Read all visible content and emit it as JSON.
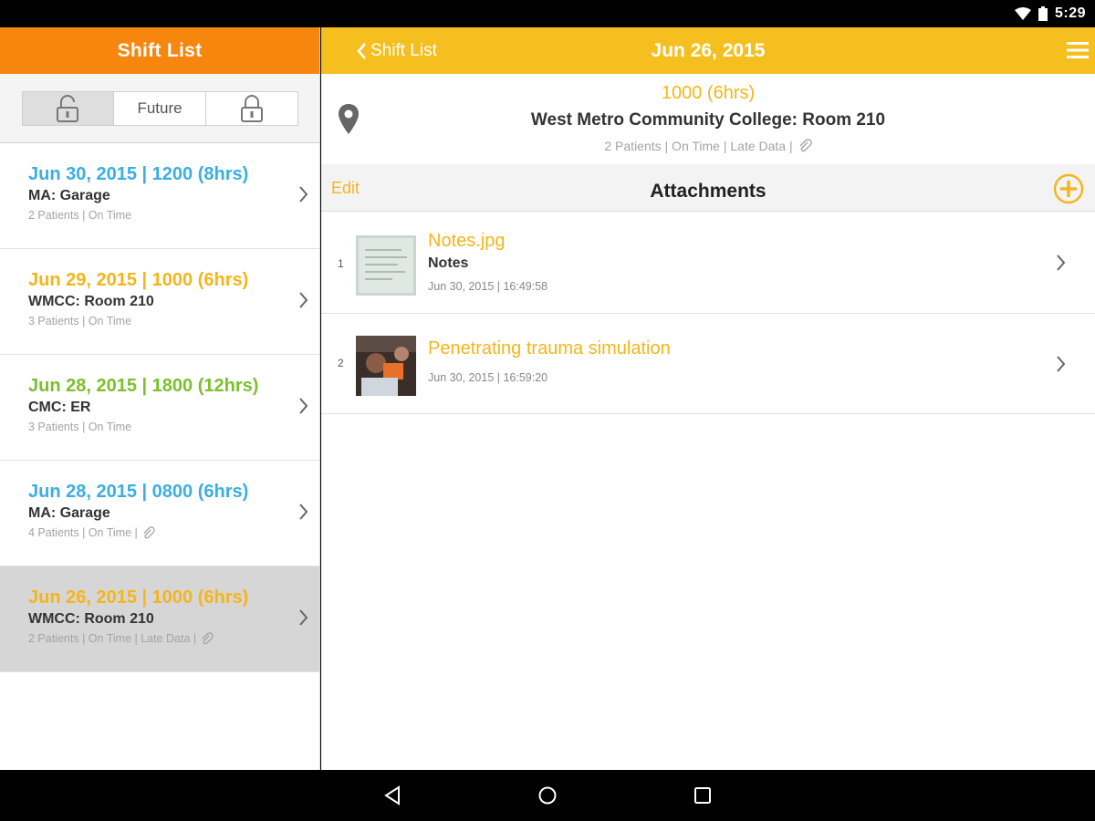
{
  "status": {
    "time": "5:29"
  },
  "left": {
    "header": "Shift List",
    "segments": {
      "future": "Future"
    },
    "shifts": [
      {
        "title": "Jun 30, 2015 | 1200 (8hrs)",
        "location": "MA: Garage",
        "meta": "2 Patients | On Time",
        "color": "#3aaee3",
        "attachment": false,
        "selected": false
      },
      {
        "title": "Jun 29, 2015 | 1000 (6hrs)",
        "location": "WMCC: Room 210",
        "meta": "3 Patients | On Time",
        "color": "#f5b51a",
        "attachment": false,
        "selected": false
      },
      {
        "title": "Jun 28, 2015 | 1800 (12hrs)",
        "location": "CMC: ER",
        "meta": "3 Patients | On Time",
        "color": "#7cc02a",
        "attachment": false,
        "selected": false
      },
      {
        "title": "Jun 28, 2015 | 0800 (6hrs)",
        "location": "MA: Garage",
        "meta": "4 Patients | On Time |",
        "color": "#3aaee3",
        "attachment": true,
        "selected": false
      },
      {
        "title": "Jun 26, 2015 | 1000 (6hrs)",
        "location": "WMCC: Room 210",
        "meta": "2 Patients | On Time | Late Data |",
        "color": "#f5b51a",
        "attachment": true,
        "selected": true
      }
    ]
  },
  "right": {
    "back_label": "Shift List",
    "title": "Jun 26, 2015",
    "detail": {
      "time": "1000 (6hrs)",
      "place": "West Metro Community College: Room 210",
      "meta": "2 Patients | On Time | Late Data |"
    },
    "attachments_bar": {
      "edit": "Edit",
      "title": "Attachments"
    },
    "attachments": [
      {
        "num": "1",
        "name": "Notes.jpg",
        "desc": "Notes",
        "date": "Jun 30, 2015 | 16:49:58"
      },
      {
        "num": "2",
        "name": "Penetrating trauma simulation",
        "desc": "",
        "date": "Jun 30, 2015 | 16:59:20"
      }
    ]
  },
  "colors": {
    "orange": "#f7860f",
    "yellow": "#f5bf20",
    "accent": "#f5b51a",
    "blue": "#3aaee3",
    "green": "#7cc02a"
  }
}
